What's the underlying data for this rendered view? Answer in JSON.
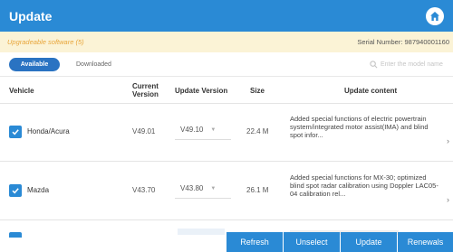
{
  "header": {
    "title": "Update",
    "home_icon": "home-icon"
  },
  "info": {
    "upgradable": "Upgradeable software (5)",
    "serial": "Serial Number:  987940001160"
  },
  "tabs": {
    "active": "Available",
    "inactive": "Downloaded"
  },
  "search": {
    "placeholder": "Enter the model name"
  },
  "table": {
    "headers": {
      "vehicle": "Vehicle",
      "current": "Current Version",
      "update": "Update Version",
      "size": "Size",
      "content": "Update content"
    },
    "rows": [
      {
        "vehicle": "Honda/Acura",
        "current": "V49.01",
        "update": "V49.10",
        "size": "22.4 M",
        "content": "Added special functions of electric powertrain system/integrated motor assist(IMA) and blind spot infor...",
        "checked": true
      },
      {
        "vehicle": "Mazda",
        "current": "V43.70",
        "update": "V43.80",
        "size": "26.1 M",
        "content": "Added special functions for MX-30; optimized blind spot radar calibration using Doppler LAC05-04 calibration rel...",
        "checked": true
      }
    ]
  },
  "footer": {
    "refresh": "Refresh",
    "unselect": "Unselect",
    "update": "Update",
    "renewals": "Renewals"
  },
  "colors": {
    "primary": "#2a8ad5",
    "info_bg": "#fbf3d6",
    "info_text": "#e8a53a"
  }
}
